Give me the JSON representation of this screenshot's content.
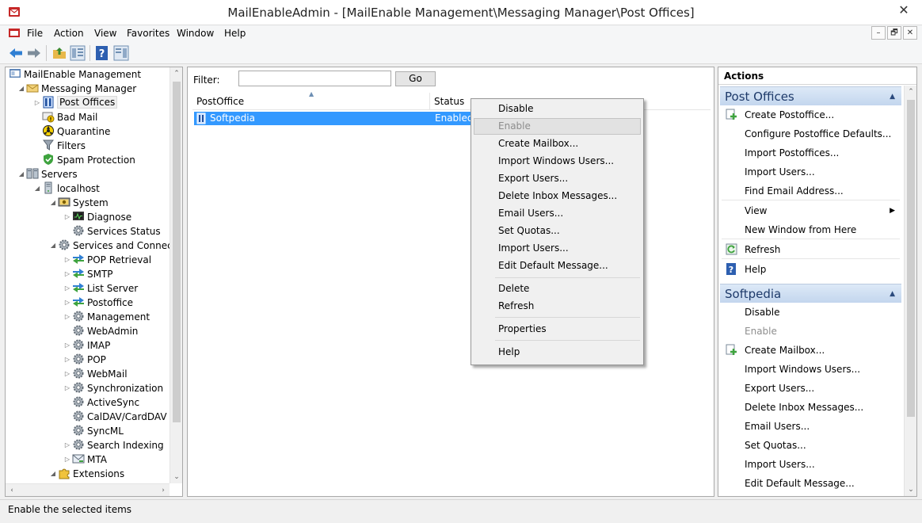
{
  "window": {
    "title": "MailEnableAdmin - [MailEnable Management\\Messaging Manager\\Post Offices]",
    "close_glyph": "✕"
  },
  "menu": [
    "File",
    "Action",
    "View",
    "Favorites",
    "Window",
    "Help"
  ],
  "mdi_controls": [
    "–",
    "🗗",
    "✕"
  ],
  "tree": [
    {
      "label": "MailEnable Management",
      "level": 0,
      "arrow": "",
      "icon": "console-icon"
    },
    {
      "label": "Messaging Manager",
      "level": 1,
      "arrow": "◢",
      "icon": "envelope-icon"
    },
    {
      "label": "Post Offices",
      "level": 2,
      "arrow": "▷",
      "icon": "postoffices-icon",
      "selected": true
    },
    {
      "label": "Bad Mail",
      "level": 2,
      "arrow": "",
      "icon": "badmail-icon"
    },
    {
      "label": "Quarantine",
      "level": 2,
      "arrow": "",
      "icon": "quarantine-icon"
    },
    {
      "label": "Filters",
      "level": 2,
      "arrow": "",
      "icon": "funnel-icon"
    },
    {
      "label": "Spam Protection",
      "level": 2,
      "arrow": "",
      "icon": "shield-icon"
    },
    {
      "label": "Servers",
      "level": 1,
      "arrow": "◢",
      "icon": "servers-icon"
    },
    {
      "label": "localhost",
      "level": 2,
      "arrow": "◢",
      "icon": "server-icon"
    },
    {
      "label": "System",
      "level": 3,
      "arrow": "◢",
      "icon": "system-icon"
    },
    {
      "label": "Diagnose",
      "level": 4,
      "arrow": "▷",
      "icon": "diagnose-icon"
    },
    {
      "label": "Services Status",
      "level": 4,
      "arrow": "",
      "icon": "gear-icon"
    },
    {
      "label": "Services and Connectors",
      "level": 3,
      "arrow": "◢",
      "icon": "gear-icon"
    },
    {
      "label": "POP Retrieval",
      "level": 4,
      "arrow": "▷",
      "icon": "connector-icon"
    },
    {
      "label": "SMTP",
      "level": 4,
      "arrow": "▷",
      "icon": "connector-icon"
    },
    {
      "label": "List Server",
      "level": 4,
      "arrow": "▷",
      "icon": "connector-icon"
    },
    {
      "label": "Postoffice",
      "level": 4,
      "arrow": "▷",
      "icon": "connector-icon"
    },
    {
      "label": "Management",
      "level": 4,
      "arrow": "▷",
      "icon": "gear-icon"
    },
    {
      "label": "WebAdmin",
      "level": 4,
      "arrow": "",
      "icon": "gear-icon"
    },
    {
      "label": "IMAP",
      "level": 4,
      "arrow": "▷",
      "icon": "gear-icon"
    },
    {
      "label": "POP",
      "level": 4,
      "arrow": "▷",
      "icon": "gear-icon"
    },
    {
      "label": "WebMail",
      "level": 4,
      "arrow": "▷",
      "icon": "gear-icon"
    },
    {
      "label": "Synchronization",
      "level": 4,
      "arrow": "▷",
      "icon": "gear-icon"
    },
    {
      "label": "ActiveSync",
      "level": 4,
      "arrow": "",
      "icon": "gear-icon"
    },
    {
      "label": "CalDAV/CardDAV",
      "level": 4,
      "arrow": "",
      "icon": "gear-icon"
    },
    {
      "label": "SyncML",
      "level": 4,
      "arrow": "",
      "icon": "gear-icon"
    },
    {
      "label": "Search Indexing",
      "level": 4,
      "arrow": "▷",
      "icon": "gear-icon"
    },
    {
      "label": "MTA",
      "level": 4,
      "arrow": "▷",
      "icon": "mta-icon"
    },
    {
      "label": "Extensions",
      "level": 3,
      "arrow": "◢",
      "icon": "puzzle-icon"
    }
  ],
  "filter": {
    "label": "Filter:",
    "value": "",
    "go": "Go"
  },
  "list": {
    "columns": [
      "PostOffice",
      "Status"
    ],
    "rows": [
      {
        "name": "Softpedia",
        "status": "Enabled"
      }
    ]
  },
  "context_menu": [
    {
      "label": "Disable",
      "state": "normal"
    },
    {
      "label": "Enable",
      "state": "disabled-hover"
    },
    {
      "label": "Create Mailbox...",
      "state": "normal"
    },
    {
      "label": "Import Windows Users...",
      "state": "normal"
    },
    {
      "label": "Export Users...",
      "state": "normal"
    },
    {
      "label": "Delete Inbox Messages...",
      "state": "normal"
    },
    {
      "label": "Email Users...",
      "state": "normal"
    },
    {
      "label": "Set Quotas...",
      "state": "normal"
    },
    {
      "label": "Import Users...",
      "state": "normal"
    },
    {
      "label": "Edit Default Message...",
      "state": "normal"
    },
    {
      "label": "Delete",
      "state": "normal"
    },
    {
      "label": "Refresh",
      "state": "normal"
    },
    {
      "label": "Properties",
      "state": "normal"
    },
    {
      "label": "Help",
      "state": "normal"
    }
  ],
  "actions": {
    "title": "Actions",
    "section1": {
      "title": "Post Offices",
      "items": [
        {
          "label": "Create Postoffice...",
          "icon": "create-icon"
        },
        {
          "label": "Configure Postoffice Defaults...",
          "icon": ""
        },
        {
          "label": "Import Postoffices...",
          "icon": ""
        },
        {
          "label": "Import Users...",
          "icon": ""
        },
        {
          "label": "Find Email Address...",
          "icon": ""
        },
        {
          "label": "View",
          "icon": "",
          "submenu": true
        },
        {
          "label": "New Window from Here",
          "icon": ""
        },
        {
          "label": "Refresh",
          "icon": "refresh-icon"
        },
        {
          "label": "Help",
          "icon": "help-icon"
        }
      ]
    },
    "section2": {
      "title": "Softpedia",
      "items": [
        {
          "label": "Disable",
          "icon": ""
        },
        {
          "label": "Enable",
          "icon": "",
          "disabled": true
        },
        {
          "label": "Create Mailbox...",
          "icon": "create-icon"
        },
        {
          "label": "Import Windows Users...",
          "icon": ""
        },
        {
          "label": "Export Users...",
          "icon": ""
        },
        {
          "label": "Delete Inbox Messages...",
          "icon": ""
        },
        {
          "label": "Email Users...",
          "icon": ""
        },
        {
          "label": "Set Quotas...",
          "icon": ""
        },
        {
          "label": "Import Users...",
          "icon": ""
        },
        {
          "label": "Edit Default Message...",
          "icon": ""
        }
      ]
    }
  },
  "status": "Enable the selected items",
  "colors": {
    "selection": "#3399ff",
    "section_header": "#c3d6ee",
    "accent_green": "#5aa02c"
  }
}
